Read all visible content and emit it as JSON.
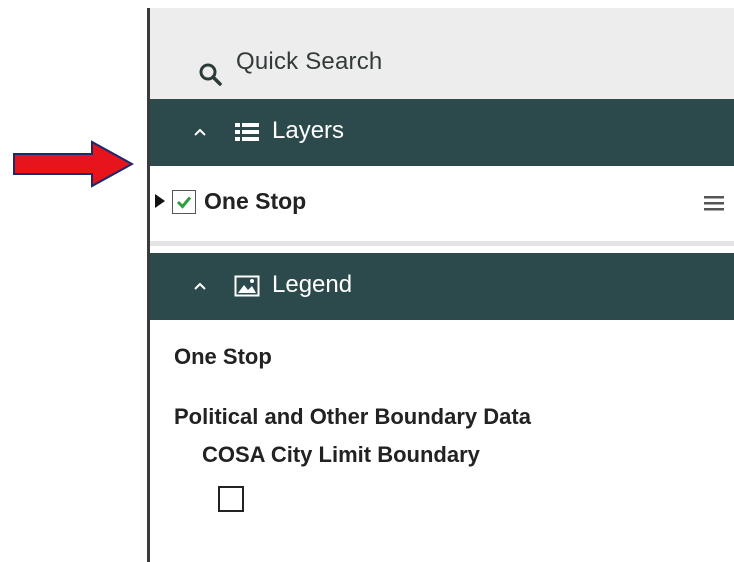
{
  "search": {
    "label": "Quick Search",
    "icon": "search-icon"
  },
  "layers": {
    "header_label": "Layers",
    "icon": "list-icon",
    "items": [
      {
        "label": "One Stop",
        "checked": true
      }
    ]
  },
  "legend": {
    "header_label": "Legend",
    "icon": "image-icon",
    "title": "One Stop",
    "group": "Political and Other Boundary Data",
    "item": "COSA City Limit Boundary"
  },
  "colors": {
    "header_bg": "#2c4a4c",
    "search_bg": "#ededed",
    "arrow": "#e8141b",
    "check": "#2e9e3e"
  }
}
